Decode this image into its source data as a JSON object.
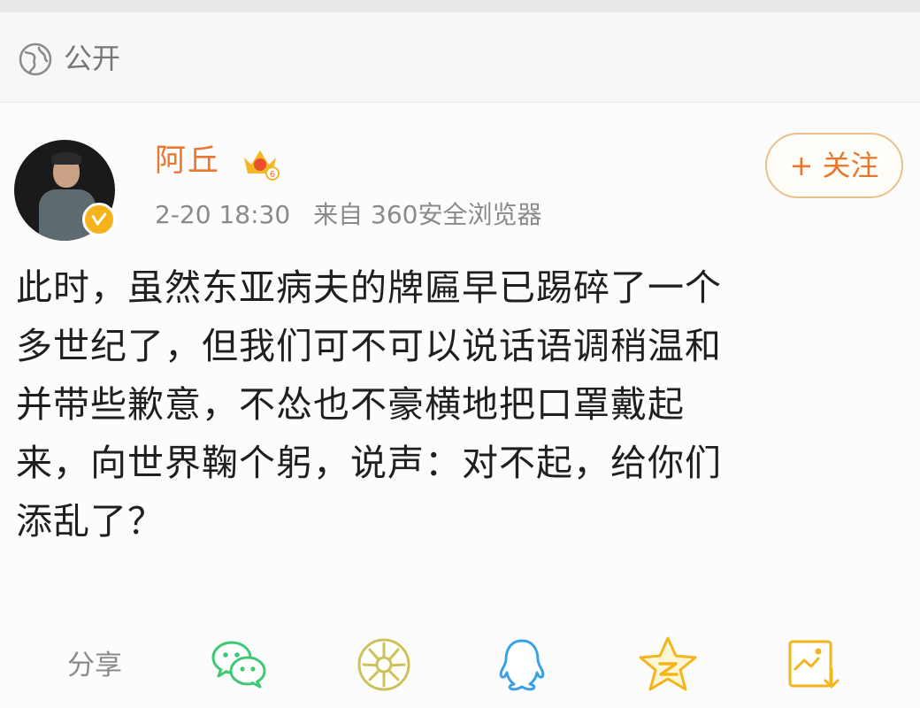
{
  "visibility": {
    "label": "公开",
    "icon": "globe-icon"
  },
  "post": {
    "author": {
      "name": "阿丘",
      "avatar": "avatar",
      "verified_icon": "verified-badge-icon",
      "level_icon": "level-badge-icon",
      "level_number": "6"
    },
    "timestamp": "2-20 18:30",
    "source": "来自 360安全浏览器",
    "follow_label": "+ 关注",
    "content_lines": [
      "此时，虽然东亚病夫的牌匾早已踢碎了一个",
      "多世纪了，但我们可不可以说话语调稍温和",
      "并带些歉意，不怂也不豪横地把口罩戴起",
      "来，向世界鞠个躬，说声：对不起，给你们",
      "添乱了？"
    ]
  },
  "share": {
    "label": "分享",
    "icons": [
      "wechat-icon",
      "moments-icon",
      "qq-icon",
      "qzone-icon",
      "save-image-icon"
    ]
  },
  "colors": {
    "accent": "#e8762c",
    "muted": "#8a8a8a",
    "text": "#1f1f1f",
    "share_green": "#3ec873",
    "share_yellow": "#f3b51b",
    "share_blue": "#3aa0e8"
  }
}
